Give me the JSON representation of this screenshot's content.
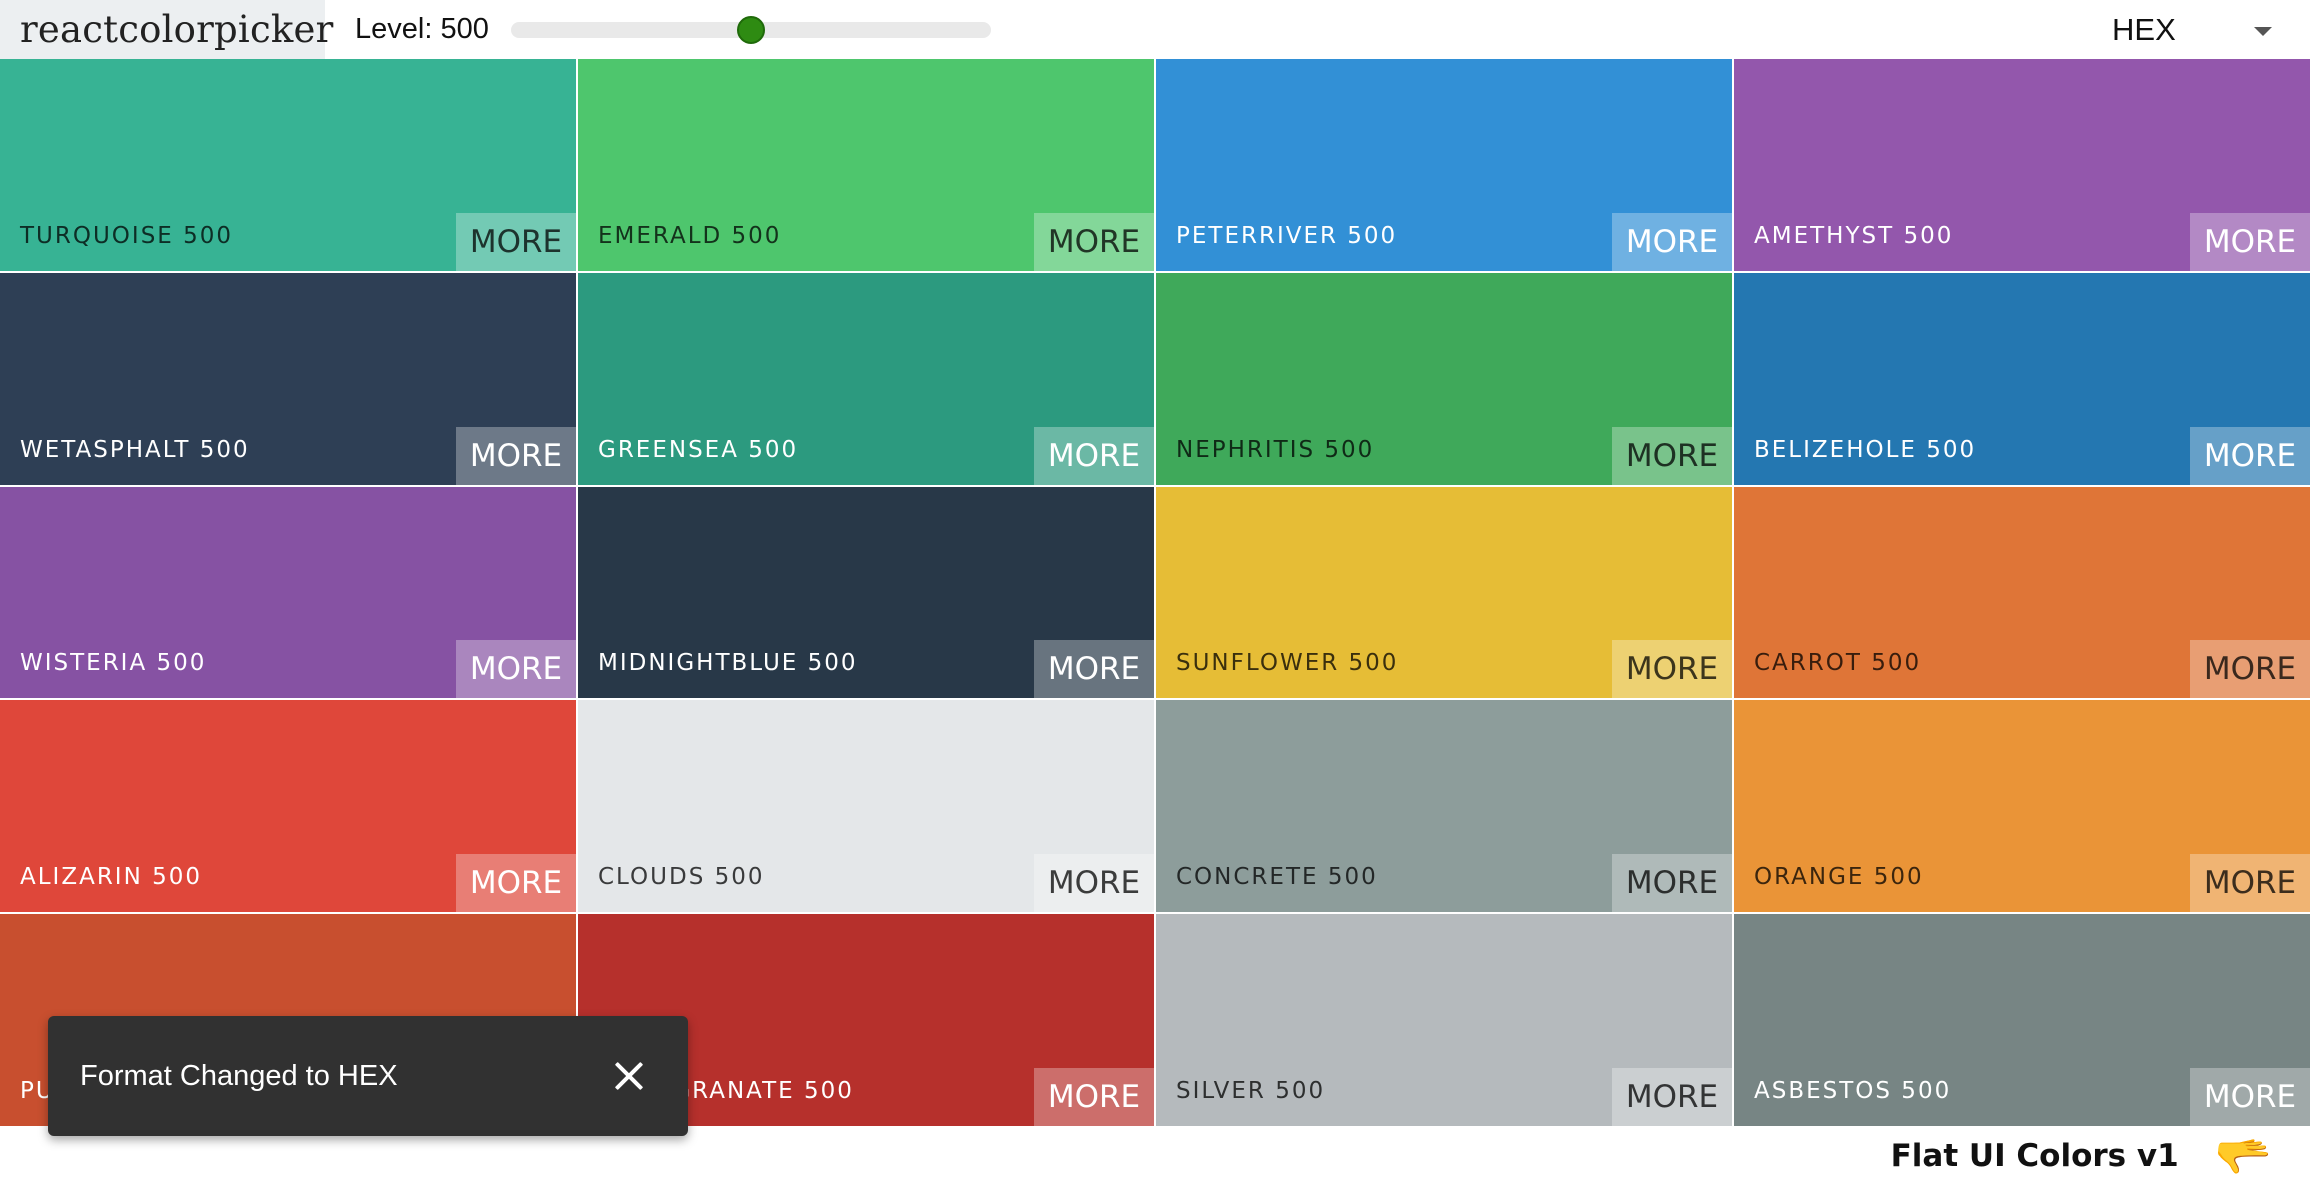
{
  "navbar": {
    "logo": "reactcolorpicker",
    "level_label": "Level: 500",
    "level_value": 500,
    "level_min": 100,
    "level_max": 900,
    "slider_fill_fraction": 0.5,
    "slider_color": "#2e8b12",
    "format_value": "HEX"
  },
  "palette": {
    "more_label": "MORE",
    "colors": [
      {
        "name": "turquoise 500",
        "hex": "#37b394",
        "text": "dark"
      },
      {
        "name": "emerald 500",
        "hex": "#4ec66d",
        "text": "dark"
      },
      {
        "name": "peterriver 500",
        "hex": "#3290d6",
        "text": "light"
      },
      {
        "name": "amethyst 500",
        "hex": "#9357ac",
        "text": "light"
      },
      {
        "name": "wetasphalt 500",
        "hex": "#2e3f55",
        "text": "light"
      },
      {
        "name": "greensea 500",
        "hex": "#2c9a7f",
        "text": "light"
      },
      {
        "name": "nephritis 500",
        "hex": "#3fa95a",
        "text": "dark"
      },
      {
        "name": "belizehole 500",
        "hex": "#2477b1",
        "text": "light"
      },
      {
        "name": "wisteria 500",
        "hex": "#8652a3",
        "text": "light"
      },
      {
        "name": "midnightblue 500",
        "hex": "#283848",
        "text": "light"
      },
      {
        "name": "sunflower 500",
        "hex": "#e6bd36",
        "text": "dark"
      },
      {
        "name": "carrot 500",
        "hex": "#df7537",
        "text": "dark"
      },
      {
        "name": "alizarin 500",
        "hex": "#df473a",
        "text": "light"
      },
      {
        "name": "clouds 500",
        "hex": "#e4e7e9",
        "text": "dark"
      },
      {
        "name": "concrete 500",
        "hex": "#8d9d9b",
        "text": "dark"
      },
      {
        "name": "orange 500",
        "hex": "#ea9437",
        "text": "dark"
      },
      {
        "name": "pumpkin 500",
        "hex": "#c84f2f",
        "text": "light"
      },
      {
        "name": "pomegranate 500",
        "hex": "#b6302c",
        "text": "light"
      },
      {
        "name": "silver 500",
        "hex": "#b5babd",
        "text": "dark"
      },
      {
        "name": "asbestos 500",
        "hex": "#778584",
        "text": "light"
      }
    ]
  },
  "footer": {
    "title": "Flat UI Colors v1",
    "emoji": "🫳"
  },
  "snackbar": {
    "message": "Format Changed to HEX"
  }
}
